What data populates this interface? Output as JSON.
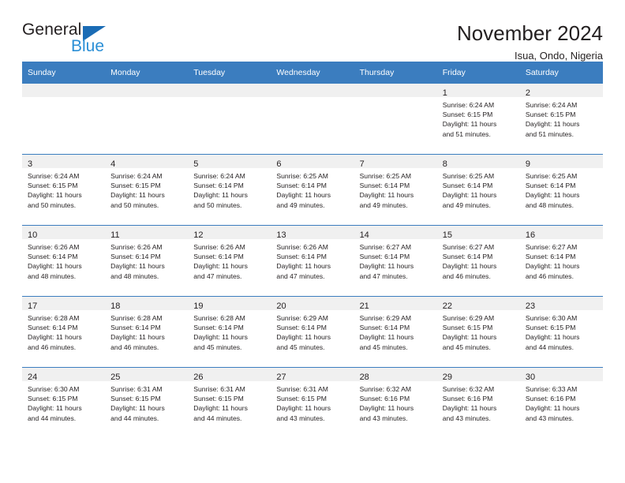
{
  "brand": {
    "name_part1": "General",
    "name_part2": "Blue",
    "accent_color": "#2b8fd6",
    "triangle_color": "#1b6cb5",
    "triangle_icon": "triangle-icon"
  },
  "header": {
    "title": "November 2024",
    "subtitle": "Isua, Ondo, Nigeria"
  },
  "calendar": {
    "header_bg": "#3b7dbf",
    "daynum_bg": "#f0f0f0",
    "weekdays": [
      "Sunday",
      "Monday",
      "Tuesday",
      "Wednesday",
      "Thursday",
      "Friday",
      "Saturday"
    ],
    "weeks": [
      [
        {
          "day": "",
          "sunrise": "",
          "sunset": "",
          "daylight_line1": "",
          "daylight_line2": "",
          "empty": true
        },
        {
          "day": "",
          "sunrise": "",
          "sunset": "",
          "daylight_line1": "",
          "daylight_line2": "",
          "empty": true
        },
        {
          "day": "",
          "sunrise": "",
          "sunset": "",
          "daylight_line1": "",
          "daylight_line2": "",
          "empty": true
        },
        {
          "day": "",
          "sunrise": "",
          "sunset": "",
          "daylight_line1": "",
          "daylight_line2": "",
          "empty": true
        },
        {
          "day": "",
          "sunrise": "",
          "sunset": "",
          "daylight_line1": "",
          "daylight_line2": "",
          "empty": true
        },
        {
          "day": "1",
          "sunrise": "Sunrise: 6:24 AM",
          "sunset": "Sunset: 6:15 PM",
          "daylight_line1": "Daylight: 11 hours",
          "daylight_line2": "and 51 minutes.",
          "empty": false
        },
        {
          "day": "2",
          "sunrise": "Sunrise: 6:24 AM",
          "sunset": "Sunset: 6:15 PM",
          "daylight_line1": "Daylight: 11 hours",
          "daylight_line2": "and 51 minutes.",
          "empty": false
        }
      ],
      [
        {
          "day": "3",
          "sunrise": "Sunrise: 6:24 AM",
          "sunset": "Sunset: 6:15 PM",
          "daylight_line1": "Daylight: 11 hours",
          "daylight_line2": "and 50 minutes.",
          "empty": false
        },
        {
          "day": "4",
          "sunrise": "Sunrise: 6:24 AM",
          "sunset": "Sunset: 6:15 PM",
          "daylight_line1": "Daylight: 11 hours",
          "daylight_line2": "and 50 minutes.",
          "empty": false
        },
        {
          "day": "5",
          "sunrise": "Sunrise: 6:24 AM",
          "sunset": "Sunset: 6:14 PM",
          "daylight_line1": "Daylight: 11 hours",
          "daylight_line2": "and 50 minutes.",
          "empty": false
        },
        {
          "day": "6",
          "sunrise": "Sunrise: 6:25 AM",
          "sunset": "Sunset: 6:14 PM",
          "daylight_line1": "Daylight: 11 hours",
          "daylight_line2": "and 49 minutes.",
          "empty": false
        },
        {
          "day": "7",
          "sunrise": "Sunrise: 6:25 AM",
          "sunset": "Sunset: 6:14 PM",
          "daylight_line1": "Daylight: 11 hours",
          "daylight_line2": "and 49 minutes.",
          "empty": false
        },
        {
          "day": "8",
          "sunrise": "Sunrise: 6:25 AM",
          "sunset": "Sunset: 6:14 PM",
          "daylight_line1": "Daylight: 11 hours",
          "daylight_line2": "and 49 minutes.",
          "empty": false
        },
        {
          "day": "9",
          "sunrise": "Sunrise: 6:25 AM",
          "sunset": "Sunset: 6:14 PM",
          "daylight_line1": "Daylight: 11 hours",
          "daylight_line2": "and 48 minutes.",
          "empty": false
        }
      ],
      [
        {
          "day": "10",
          "sunrise": "Sunrise: 6:26 AM",
          "sunset": "Sunset: 6:14 PM",
          "daylight_line1": "Daylight: 11 hours",
          "daylight_line2": "and 48 minutes.",
          "empty": false
        },
        {
          "day": "11",
          "sunrise": "Sunrise: 6:26 AM",
          "sunset": "Sunset: 6:14 PM",
          "daylight_line1": "Daylight: 11 hours",
          "daylight_line2": "and 48 minutes.",
          "empty": false
        },
        {
          "day": "12",
          "sunrise": "Sunrise: 6:26 AM",
          "sunset": "Sunset: 6:14 PM",
          "daylight_line1": "Daylight: 11 hours",
          "daylight_line2": "and 47 minutes.",
          "empty": false
        },
        {
          "day": "13",
          "sunrise": "Sunrise: 6:26 AM",
          "sunset": "Sunset: 6:14 PM",
          "daylight_line1": "Daylight: 11 hours",
          "daylight_line2": "and 47 minutes.",
          "empty": false
        },
        {
          "day": "14",
          "sunrise": "Sunrise: 6:27 AM",
          "sunset": "Sunset: 6:14 PM",
          "daylight_line1": "Daylight: 11 hours",
          "daylight_line2": "and 47 minutes.",
          "empty": false
        },
        {
          "day": "15",
          "sunrise": "Sunrise: 6:27 AM",
          "sunset": "Sunset: 6:14 PM",
          "daylight_line1": "Daylight: 11 hours",
          "daylight_line2": "and 46 minutes.",
          "empty": false
        },
        {
          "day": "16",
          "sunrise": "Sunrise: 6:27 AM",
          "sunset": "Sunset: 6:14 PM",
          "daylight_line1": "Daylight: 11 hours",
          "daylight_line2": "and 46 minutes.",
          "empty": false
        }
      ],
      [
        {
          "day": "17",
          "sunrise": "Sunrise: 6:28 AM",
          "sunset": "Sunset: 6:14 PM",
          "daylight_line1": "Daylight: 11 hours",
          "daylight_line2": "and 46 minutes.",
          "empty": false
        },
        {
          "day": "18",
          "sunrise": "Sunrise: 6:28 AM",
          "sunset": "Sunset: 6:14 PM",
          "daylight_line1": "Daylight: 11 hours",
          "daylight_line2": "and 46 minutes.",
          "empty": false
        },
        {
          "day": "19",
          "sunrise": "Sunrise: 6:28 AM",
          "sunset": "Sunset: 6:14 PM",
          "daylight_line1": "Daylight: 11 hours",
          "daylight_line2": "and 45 minutes.",
          "empty": false
        },
        {
          "day": "20",
          "sunrise": "Sunrise: 6:29 AM",
          "sunset": "Sunset: 6:14 PM",
          "daylight_line1": "Daylight: 11 hours",
          "daylight_line2": "and 45 minutes.",
          "empty": false
        },
        {
          "day": "21",
          "sunrise": "Sunrise: 6:29 AM",
          "sunset": "Sunset: 6:14 PM",
          "daylight_line1": "Daylight: 11 hours",
          "daylight_line2": "and 45 minutes.",
          "empty": false
        },
        {
          "day": "22",
          "sunrise": "Sunrise: 6:29 AM",
          "sunset": "Sunset: 6:15 PM",
          "daylight_line1": "Daylight: 11 hours",
          "daylight_line2": "and 45 minutes.",
          "empty": false
        },
        {
          "day": "23",
          "sunrise": "Sunrise: 6:30 AM",
          "sunset": "Sunset: 6:15 PM",
          "daylight_line1": "Daylight: 11 hours",
          "daylight_line2": "and 44 minutes.",
          "empty": false
        }
      ],
      [
        {
          "day": "24",
          "sunrise": "Sunrise: 6:30 AM",
          "sunset": "Sunset: 6:15 PM",
          "daylight_line1": "Daylight: 11 hours",
          "daylight_line2": "and 44 minutes.",
          "empty": false
        },
        {
          "day": "25",
          "sunrise": "Sunrise: 6:31 AM",
          "sunset": "Sunset: 6:15 PM",
          "daylight_line1": "Daylight: 11 hours",
          "daylight_line2": "and 44 minutes.",
          "empty": false
        },
        {
          "day": "26",
          "sunrise": "Sunrise: 6:31 AM",
          "sunset": "Sunset: 6:15 PM",
          "daylight_line1": "Daylight: 11 hours",
          "daylight_line2": "and 44 minutes.",
          "empty": false
        },
        {
          "day": "27",
          "sunrise": "Sunrise: 6:31 AM",
          "sunset": "Sunset: 6:15 PM",
          "daylight_line1": "Daylight: 11 hours",
          "daylight_line2": "and 43 minutes.",
          "empty": false
        },
        {
          "day": "28",
          "sunrise": "Sunrise: 6:32 AM",
          "sunset": "Sunset: 6:16 PM",
          "daylight_line1": "Daylight: 11 hours",
          "daylight_line2": "and 43 minutes.",
          "empty": false
        },
        {
          "day": "29",
          "sunrise": "Sunrise: 6:32 AM",
          "sunset": "Sunset: 6:16 PM",
          "daylight_line1": "Daylight: 11 hours",
          "daylight_line2": "and 43 minutes.",
          "empty": false
        },
        {
          "day": "30",
          "sunrise": "Sunrise: 6:33 AM",
          "sunset": "Sunset: 6:16 PM",
          "daylight_line1": "Daylight: 11 hours",
          "daylight_line2": "and 43 minutes.",
          "empty": false
        }
      ]
    ]
  }
}
